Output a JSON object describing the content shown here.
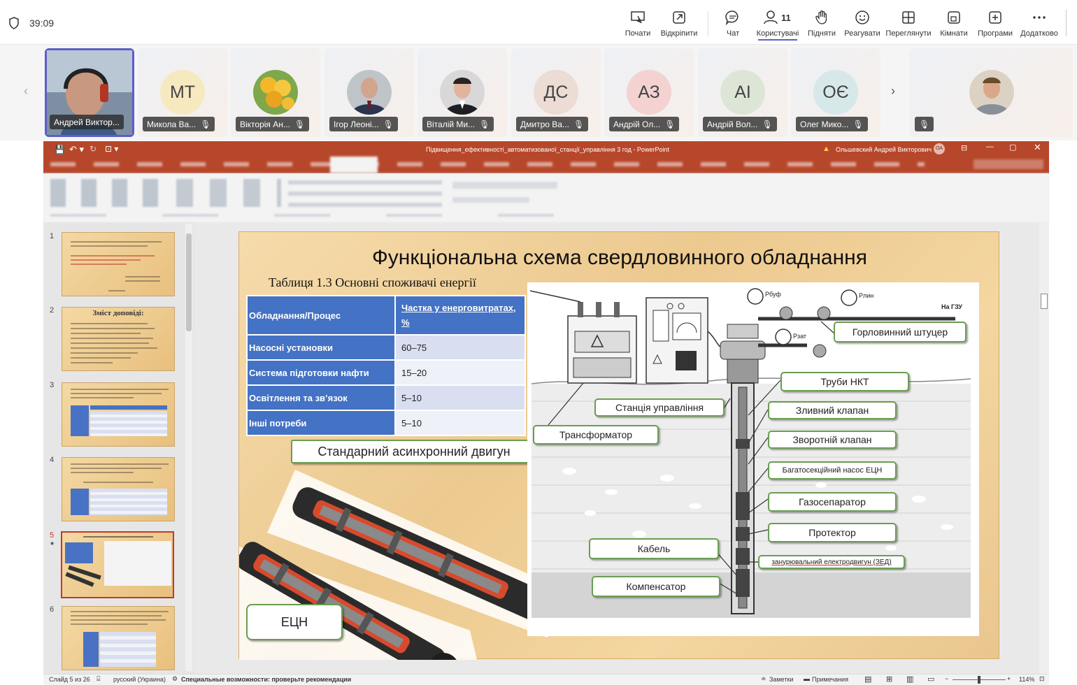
{
  "topbar": {
    "timer": "39:09",
    "users_count": "11",
    "buttons": [
      "Почати",
      "Відкріпити",
      "Чат",
      "Користувачі",
      "Підняти",
      "Реагувати",
      "Переглянути",
      "Кімнати",
      "Програми",
      "Додатково"
    ]
  },
  "participants": [
    {
      "name": "Андрей Виктор...",
      "initials": ""
    },
    {
      "name": "Микола Ва...",
      "initials": "МТ",
      "color": "#f7e9bf"
    },
    {
      "name": "Вікторія Ан...",
      "initials": ""
    },
    {
      "name": "Ігор Леоні...",
      "initials": ""
    },
    {
      "name": "Віталій Ми...",
      "initials": ""
    },
    {
      "name": "Дмитро Ва...",
      "initials": "ДС",
      "color": "#ecdcd4"
    },
    {
      "name": "Андрій Ол...",
      "initials": "АЗ",
      "color": "#f4d2d2"
    },
    {
      "name": "Андрій Вол...",
      "initials": "АІ",
      "color": "#dde6d6"
    },
    {
      "name": "Олег Мико...",
      "initials": "ОЄ",
      "color": "#d6e8ea"
    },
    {
      "name": "",
      "initials": ""
    }
  ],
  "ppt": {
    "title": "Підвищення_ефективності_автоматизованої_станції_управління 3 год  -  PowerPoint",
    "user": "Ольшевский Андрей Викторович",
    "user_initials": "ОА",
    "slide_numbers": [
      "1",
      "2",
      "3",
      "4",
      "5",
      "6"
    ],
    "thumb2_title": "Зміст доповіді:",
    "status": {
      "slide": "Слайд 5 из 26",
      "language": "русский (Украина)",
      "accessibility": "Специальные возможности: проверьте рекомендации",
      "notes": "Заметки",
      "comments": "Примечания",
      "zoom": "114%"
    }
  },
  "slide": {
    "title": "Функціональна схема  свердловинного обладнання",
    "table_caption": "Таблиця 1.3  Основні споживачі енергії",
    "table": {
      "headers": [
        "Обладнання/Процес",
        "Частка у енерговитратах, %"
      ],
      "rows": [
        [
          "Насосні установки",
          "60–75"
        ],
        [
          "Система підготовки нафти",
          "15–20"
        ],
        [
          "Освітлення та зв’язок",
          "5–10"
        ],
        [
          "Інші потреби",
          "5–10"
        ]
      ]
    },
    "motor_label": "Стандарний асинхронний двигун",
    "ecn_label": "ЕЦН",
    "diagram": {
      "gauge_p_buf": "Pбуф",
      "gauge_p_lin": "Pлин",
      "gauge_p_zat": "Pзат",
      "to_gzu": "На ГЗУ",
      "labels": [
        "Горловинний штуцер",
        "Труби НКТ",
        "Станція управління",
        "Зливний клапан",
        "Трансформатор",
        "Зворотній клапан",
        "Багатосекційний насос ЕЦН",
        "Газосепаратор",
        "Протектор",
        "Кабель",
        "занурювальний електродвигун (ЗЕД)",
        "Компенсатор"
      ]
    }
  }
}
